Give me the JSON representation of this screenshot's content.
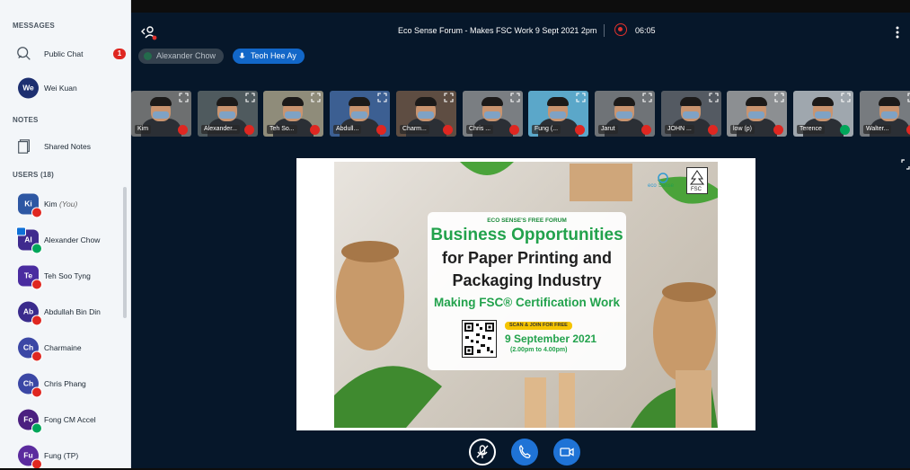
{
  "sidebar": {
    "messages_header": "MESSAGES",
    "public_chat": {
      "label": "Public Chat",
      "badge": "1"
    },
    "private_chats": [
      {
        "initials": "We",
        "label": "Wei Kuan",
        "color": "#1d2f70"
      }
    ],
    "notes_header": "NOTES",
    "shared_notes": "Shared Notes",
    "users_header": "USERS (18)",
    "users": [
      {
        "initials": "Ki",
        "name": "Kim",
        "suffix": "(You)",
        "color": "#2d57a3",
        "mic": "off",
        "round": false
      },
      {
        "initials": "Al",
        "name": "Alexander Chow",
        "suffix": "",
        "color": "#3f2a8e",
        "mic": "on",
        "round": false,
        "presenter": true
      },
      {
        "initials": "Te",
        "name": "Teh Soo Tyng",
        "suffix": "",
        "color": "#4a2ca0",
        "mic": "off",
        "round": false
      },
      {
        "initials": "Ab",
        "name": "Abdullah Bin Din",
        "suffix": "",
        "color": "#3a2b8c",
        "mic": "off",
        "round": true
      },
      {
        "initials": "Ch",
        "name": "Charmaine",
        "suffix": "",
        "color": "#3b47a5",
        "mic": "off",
        "round": true
      },
      {
        "initials": "Ch",
        "name": "Chris Phang",
        "suffix": "",
        "color": "#3b47a5",
        "mic": "off",
        "round": true
      },
      {
        "initials": "Fo",
        "name": "Fong CM Accel",
        "suffix": "",
        "color": "#4b1f80",
        "mic": "on",
        "round": true
      },
      {
        "initials": "Fu",
        "name": "Fung (TP)",
        "suffix": "",
        "color": "#5b2b9e",
        "mic": "off",
        "round": true
      }
    ]
  },
  "topbar": {
    "title": "Eco Sense Forum - Makes FSC Work 9 Sept 2021 2pm",
    "timer": "06:05"
  },
  "talkers": [
    "Alexander Chow",
    "Teoh Hee Ay"
  ],
  "videos": [
    {
      "name": "Kim",
      "mic": "off",
      "bg": "#6d6f70"
    },
    {
      "name": "Alexander...",
      "mic": "off",
      "bg": "#4f5a5e"
    },
    {
      "name": "Teh So...",
      "mic": "off",
      "bg": "#8f8c7a"
    },
    {
      "name": "Abdull...",
      "mic": "off",
      "bg": "#3c5f92"
    },
    {
      "name": "Charm...",
      "mic": "off",
      "bg": "#5e4d42"
    },
    {
      "name": "Chris ...",
      "mic": "off",
      "bg": "#7a7e82"
    },
    {
      "name": "Fung (...",
      "mic": "off",
      "bg": "#5ba7c9"
    },
    {
      "name": "Jarut",
      "mic": "off",
      "bg": "#6f7377"
    },
    {
      "name": "JOHN ...",
      "mic": "off",
      "bg": "#545a62"
    },
    {
      "name": "low (p)",
      "mic": "off",
      "bg": "#8c8f92"
    },
    {
      "name": "Terence",
      "mic": "on",
      "bg": "#9fa7ae"
    },
    {
      "name": "Walter...",
      "mic": "off",
      "bg": "#777b7f"
    }
  ],
  "slide": {
    "pre_title": "ECO SENSE'S FREE FORUM",
    "line1": "Business Opportunities",
    "line2": "for Paper Printing and",
    "line3": "Packaging Industry",
    "line4": "Making FSC® Certification Work",
    "scan": "SCAN & JOIN FOR FREE",
    "date": "9 September  2021",
    "time": "(2.00pm to 4.00pm)",
    "eco_logo_text": "ecoSense",
    "fsc_logo_text": "FSC"
  },
  "colors": {
    "accent": "#1f73d6",
    "mic_off": "#df2721",
    "mic_on": "#00a65a",
    "brand_green": "#22a24c"
  }
}
